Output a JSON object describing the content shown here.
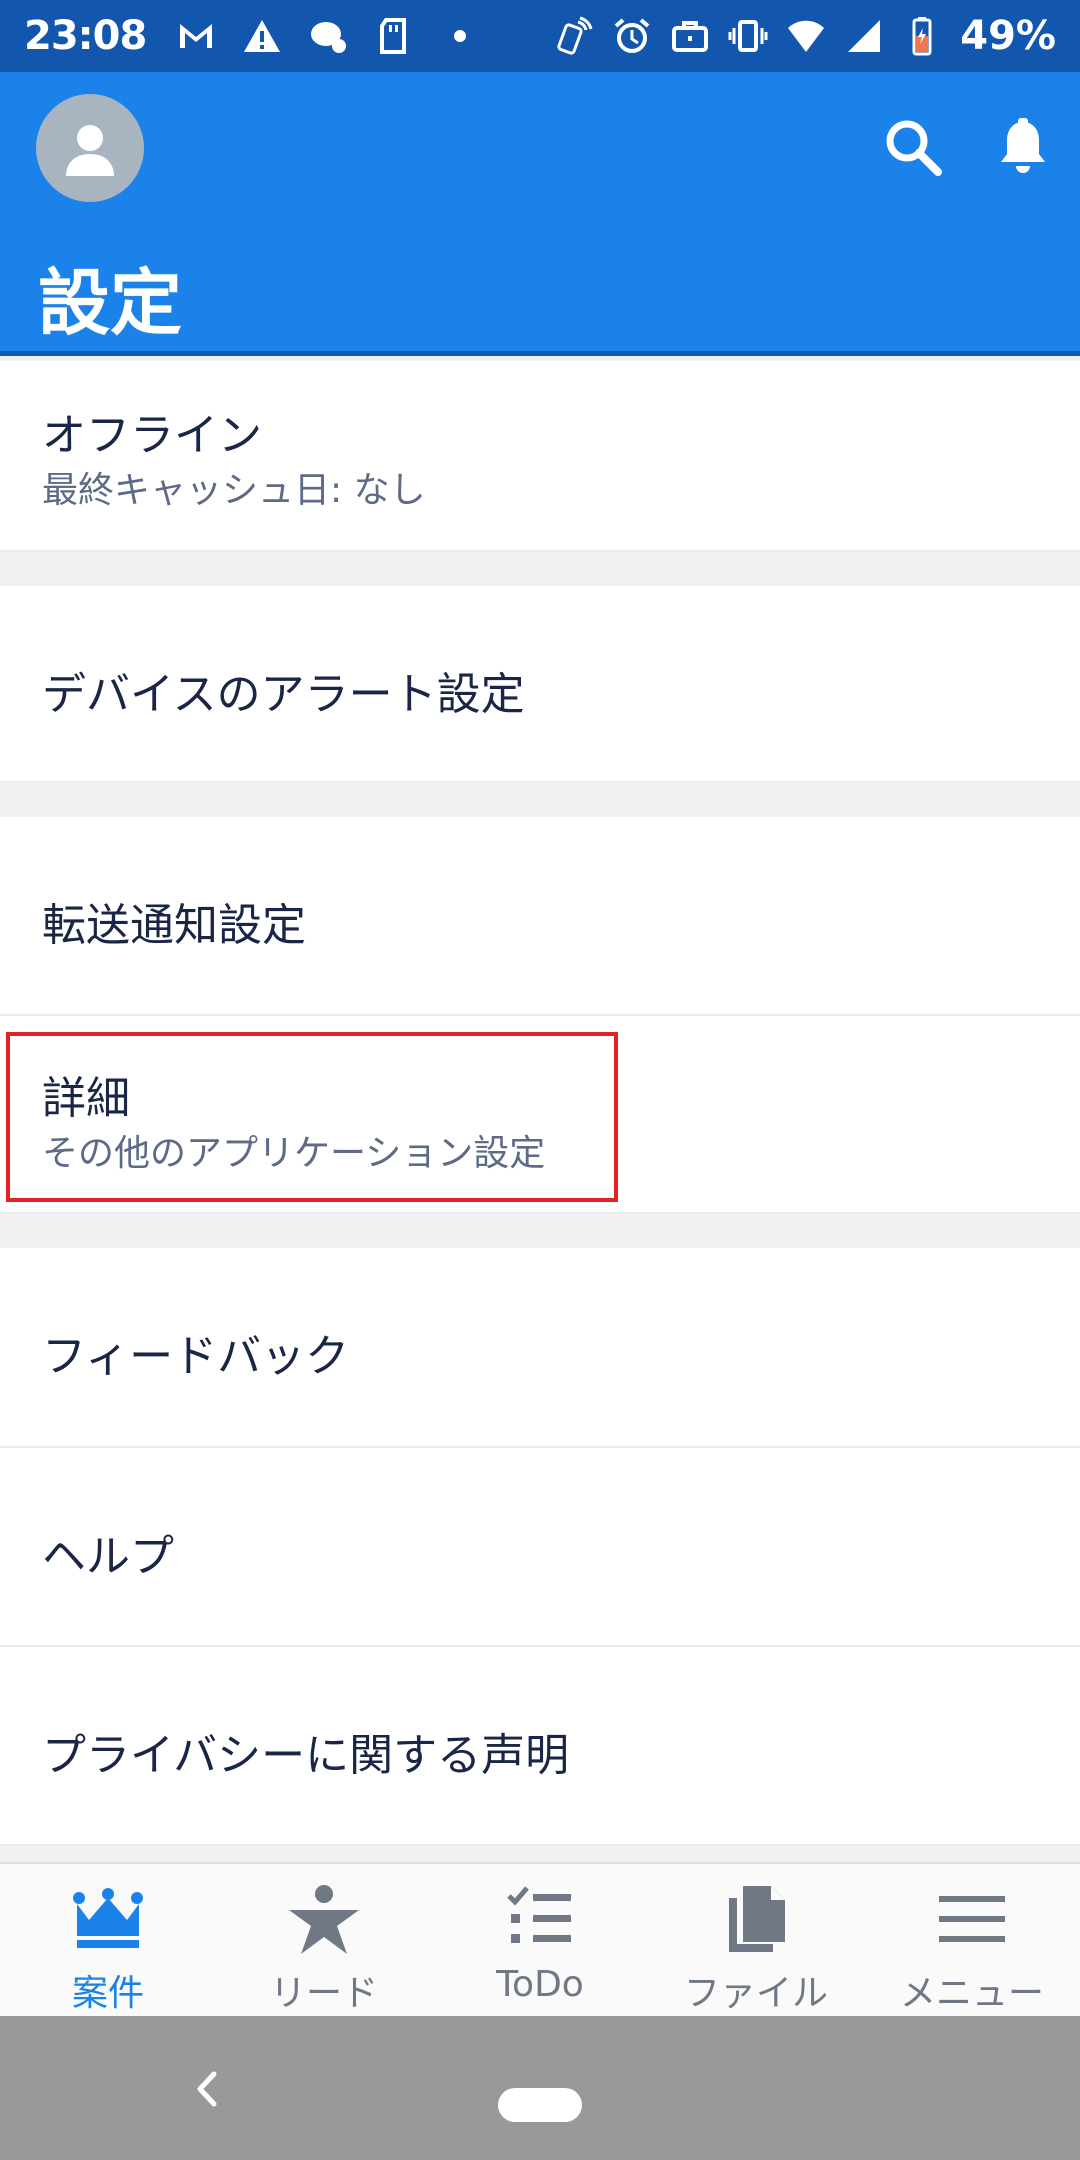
{
  "status_bar": {
    "time": "23:08",
    "battery": "49%",
    "left_icons": [
      "gmail-icon",
      "warning-icon",
      "chat-icon",
      "sd-card-icon",
      "dot-icon"
    ],
    "right_icons": [
      "nfc-icon",
      "alarm-icon",
      "briefcase-icon",
      "vibrate-icon",
      "wifi-icon",
      "signal-icon",
      "battery-icon"
    ]
  },
  "header": {
    "title": "設定",
    "colors": {
      "background": "#1b82ea",
      "status_bar": "#1257ad"
    }
  },
  "settings": {
    "offline": {
      "title": "オフライン",
      "subtitle": "最終キャッシュ日: なし"
    },
    "device_alert": {
      "title": "デバイスのアラート設定"
    },
    "forward_notify": {
      "title": "転送通知設定"
    },
    "advanced": {
      "title": "詳細",
      "subtitle": "その他のアプリケーション設定"
    },
    "feedback": {
      "title": "フィードバック"
    },
    "help": {
      "title": "ヘルプ"
    },
    "privacy": {
      "title": "プライバシーに関する声明"
    }
  },
  "bottom_nav": {
    "items": [
      {
        "label": "案件",
        "icon": "crown-icon",
        "active": true
      },
      {
        "label": "リード",
        "icon": "star-person-icon",
        "active": false
      },
      {
        "label": "ToDo",
        "icon": "checklist-icon",
        "active": false
      },
      {
        "label": "ファイル",
        "icon": "files-icon",
        "active": false
      },
      {
        "label": "メニュー",
        "icon": "hamburger-icon",
        "active": false
      }
    ]
  },
  "highlight_color": "#e0222a"
}
